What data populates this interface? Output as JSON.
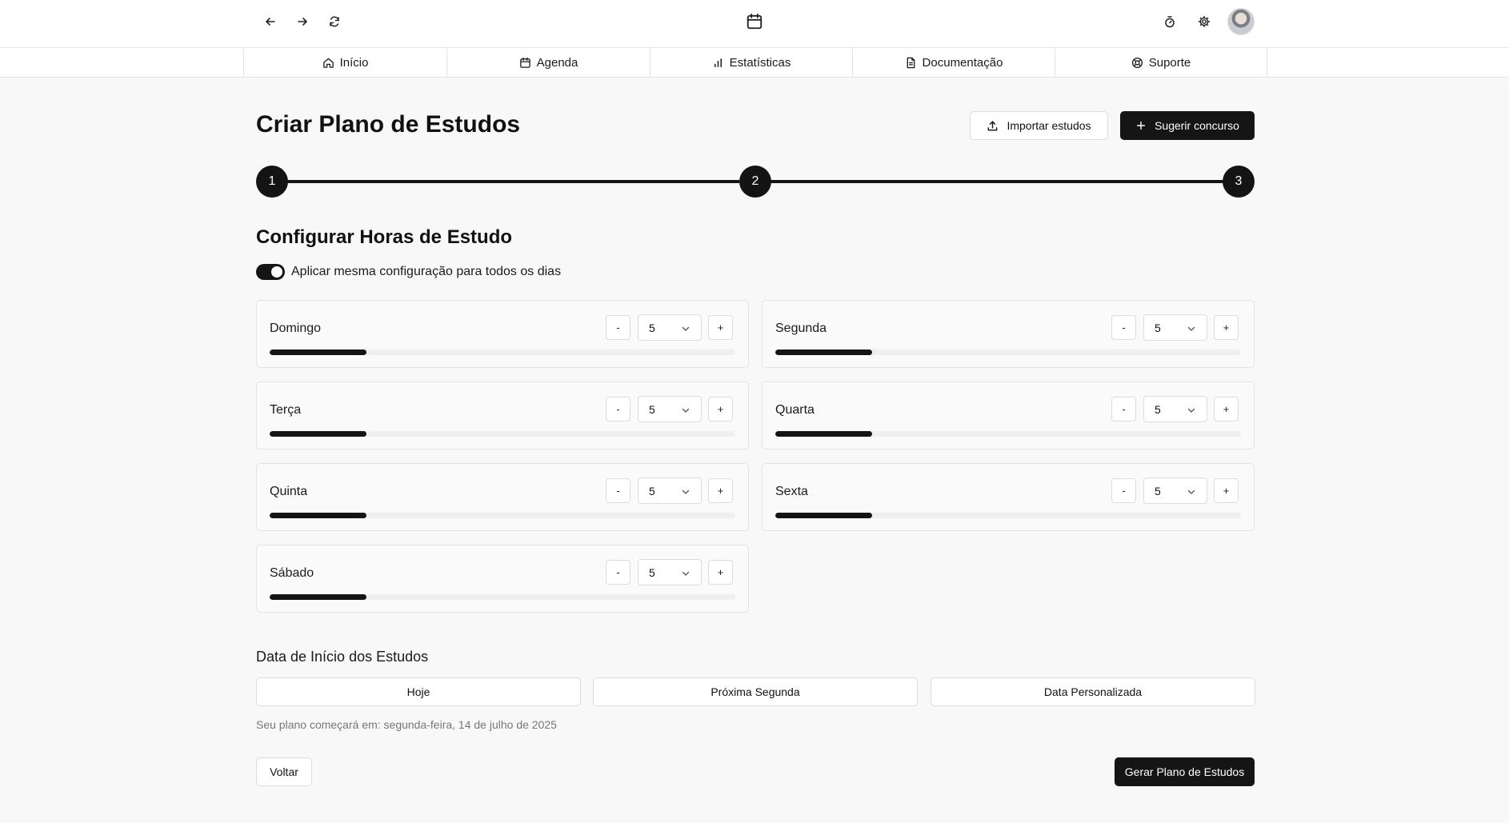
{
  "nav": {
    "items": [
      {
        "label": "Início",
        "icon": "home-icon"
      },
      {
        "label": "Agenda",
        "icon": "calendar-icon"
      },
      {
        "label": "Estatísticas",
        "icon": "bar-chart-icon"
      },
      {
        "label": "Documentação",
        "icon": "document-icon"
      },
      {
        "label": "Suporte",
        "icon": "lifebuoy-icon"
      }
    ]
  },
  "header": {
    "title": "Criar Plano de Estudos",
    "import_label": "Importar estudos",
    "suggest_label": "Sugerir concurso"
  },
  "stepper": {
    "steps": [
      "1",
      "2",
      "3"
    ],
    "current": 2
  },
  "config": {
    "title": "Configurar Horas de Estudo",
    "toggle_label": "Aplicar mesma configuração para todos os dias",
    "toggle_on": true,
    "minus_label": "-",
    "plus_label": "+",
    "max_hours": 24,
    "days": [
      {
        "name": "Domingo",
        "hours": "5"
      },
      {
        "name": "Segunda",
        "hours": "5"
      },
      {
        "name": "Terça",
        "hours": "5"
      },
      {
        "name": "Quarta",
        "hours": "5"
      },
      {
        "name": "Quinta",
        "hours": "5"
      },
      {
        "name": "Sexta",
        "hours": "5"
      },
      {
        "name": "Sábado",
        "hours": "5"
      }
    ]
  },
  "start": {
    "title": "Data de Início dos Estudos",
    "options": [
      "Hoje",
      "Próxima Segunda",
      "Data Personalizada"
    ],
    "note": "Seu plano começará em: segunda-feira, 14 de julho de 2025"
  },
  "actions": {
    "back_label": "Voltar",
    "generate_label": "Gerar Plano de Estudos"
  },
  "colors": {
    "accent": "#151515",
    "background": "#f8f8f8",
    "muted_text": "#777777"
  }
}
